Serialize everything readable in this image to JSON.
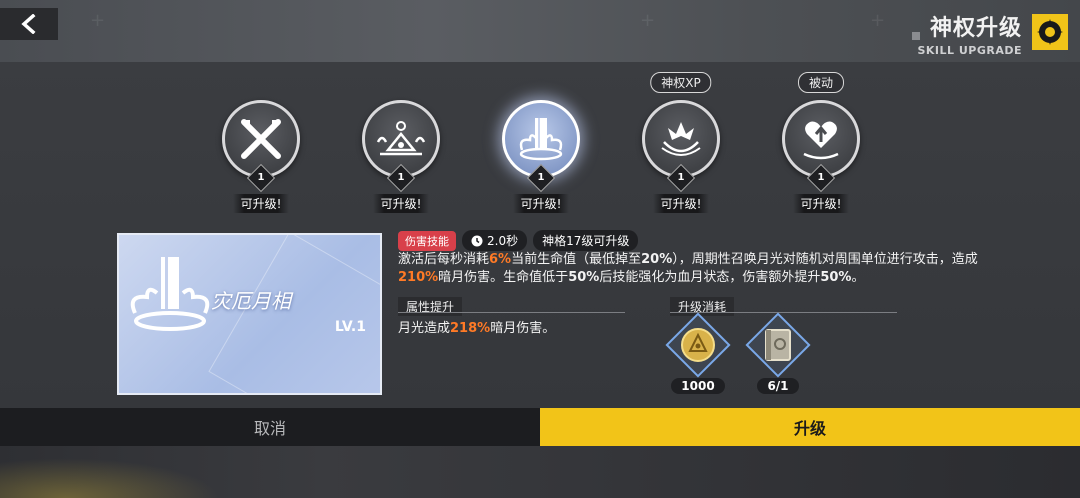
{
  "header": {
    "title_cn": "神权升级",
    "title_en": "SKILL UPGRADE"
  },
  "skills": [
    {
      "icon": "crossed-blades-icon",
      "level": "1",
      "status": "可升级!",
      "tag": ""
    },
    {
      "icon": "eye-altar-icon",
      "level": "1",
      "status": "可升级!",
      "tag": ""
    },
    {
      "icon": "moon-pillar-icon",
      "level": "1",
      "status": "可升级!",
      "tag": "",
      "selected": true
    },
    {
      "icon": "phoenix-wreath-icon",
      "level": "1",
      "status": "可升级!",
      "tag": "神权XP"
    },
    {
      "icon": "heart-rise-icon",
      "level": "1",
      "status": "可升级!",
      "tag": "被动"
    }
  ],
  "card": {
    "name": "灾厄月相",
    "level": "LV.1"
  },
  "details": {
    "type_badge": "伤害技能",
    "cooldown": "2.0秒",
    "unlock": "神格17级可升级",
    "desc_parts": [
      "激活后每秒消耗",
      "6%",
      "当前生命值（最低掉至",
      "20%",
      "），周期性召唤月光对随机对周围单位进行攻击，造成",
      "210%",
      "暗月伤害。生命值低于",
      "50%",
      "后技能强化为血月状态，伤害额外提升",
      "50%",
      "。"
    ],
    "attr_header": "属性提升",
    "attr_parts": [
      "月光造成",
      "218%",
      "暗月伤害。"
    ],
    "cost_header": "升级消耗",
    "costs": [
      {
        "icon": "gold-coin-eye-icon",
        "amount": "1000"
      },
      {
        "icon": "tome-book-icon",
        "amount": "6/1"
      }
    ]
  },
  "buttons": {
    "cancel": "取消",
    "upgrade": "升级"
  },
  "colors": {
    "accent": "#f2c418",
    "highlight": "#ff7a26",
    "damage_badge": "#d8404a"
  }
}
